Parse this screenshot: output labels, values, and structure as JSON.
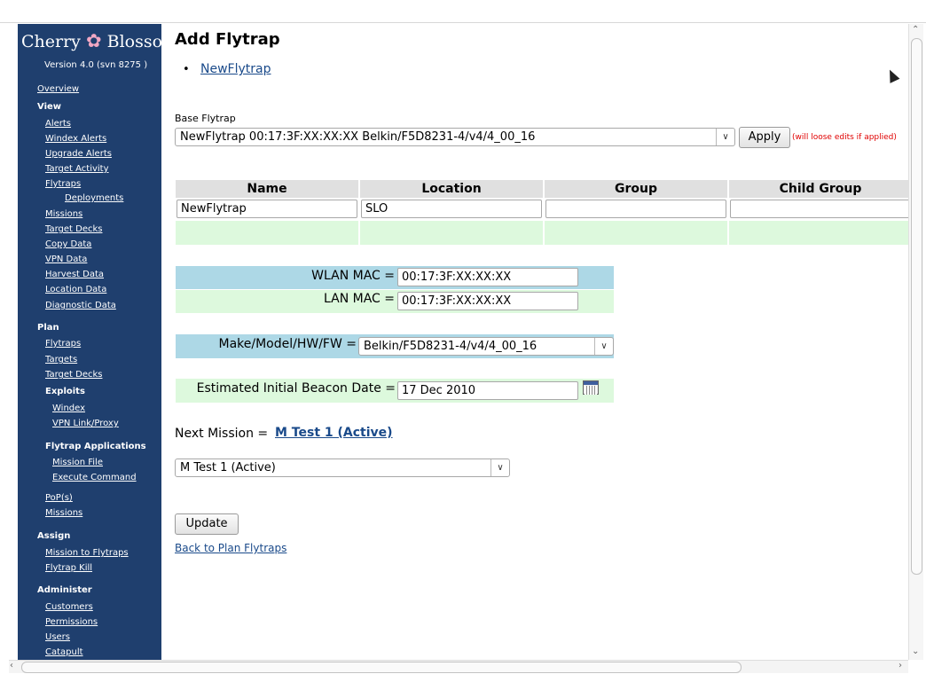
{
  "sidebar": {
    "logo_left": "Cherry",
    "logo_flower": "✿",
    "logo_right": "Blossom",
    "version": "Version 4.0 (svn 8275 )",
    "overview": "Overview",
    "view": {
      "header": "View",
      "alerts": "Alerts",
      "windex_alerts": "Windex Alerts",
      "upgrade_alerts": "Upgrade Alerts",
      "target_activity": "Target Activity",
      "flytraps": "Flytraps",
      "deployments": "Deployments",
      "missions": "Missions",
      "target_decks": "Target Decks",
      "copy_data": "Copy Data",
      "vpn_data": "VPN Data",
      "harvest_data": "Harvest Data",
      "location_data": "Location Data",
      "diagnostic_data": "Diagnostic Data"
    },
    "plan": {
      "header": "Plan",
      "flytraps": "Flytraps",
      "targets": "Targets",
      "target_decks": "Target Decks",
      "exploits_header": "Exploits",
      "windex": "Windex",
      "vpn_link_proxy": "VPN Link/Proxy",
      "flytrap_apps_header": "Flytrap Applications",
      "mission_file": "Mission File",
      "execute_command": "Execute Command",
      "pops": "PoP(s)",
      "missions": "Missions"
    },
    "assign": {
      "header": "Assign",
      "mission_to_flytraps": "Mission to Flytraps",
      "flytrap_kill": "Flytrap Kill"
    },
    "administer": {
      "header": "Administer",
      "customers": "Customers",
      "permissions": "Permissions",
      "users": "Users",
      "catapult": "Catapult"
    }
  },
  "main": {
    "title": "Add Flytrap",
    "bullet_link": "NewFlytrap",
    "base_flytrap_label": "Base Flytrap",
    "base_flytrap_value": "NewFlytrap 00:17:3F:XX:XX:XX Belkin/F5D8231-4/v4/4_00_16",
    "apply_label": "Apply",
    "apply_warning": "(will loose edits if applied)",
    "table": {
      "headers": [
        "Name",
        "Location",
        "Group",
        "Child Group"
      ],
      "values": [
        "NewFlytrap",
        "SLO",
        "",
        ""
      ]
    },
    "wlan_mac_label": "WLAN MAC =",
    "wlan_mac_value": "00:17:3F:XX:XX:XX",
    "lan_mac_label": "LAN MAC =",
    "lan_mac_value": "00:17:3F:XX:XX:XX",
    "make_model_label": "Make/Model/HW/FW =",
    "make_model_value": "Belkin/F5D8231-4/v4/4_00_16",
    "beacon_label": "Estimated Initial Beacon Date =",
    "beacon_value": "17 Dec 2010",
    "next_mission_label": "Next Mission =",
    "next_mission_link": "M Test 1 (Active)",
    "mission_select_value": "M Test 1 (Active)",
    "update_label": "Update",
    "back_link": "Back to Plan Flytraps"
  },
  "colors": {
    "sidebar_bg": "#1f3f6e",
    "link": "#1a4a8a",
    "row_blue": "#add8e6",
    "row_green": "#ddf9dd",
    "header_gray": "#e0e0e0",
    "warning": "#e00000"
  }
}
